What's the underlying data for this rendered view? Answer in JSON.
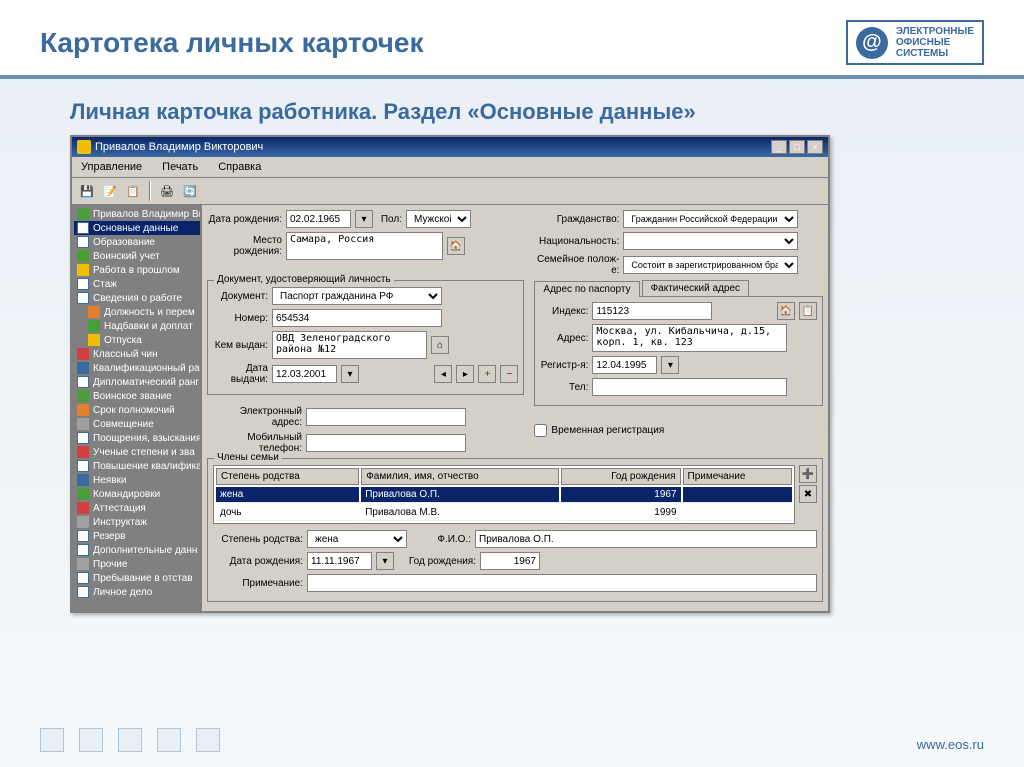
{
  "slide": {
    "title": "Картотека личных карточек",
    "subtitle": "Личная карточка работника. Раздел «Основные данные»",
    "logo_lines": [
      "ЭЛЕКТРОННЫЕ",
      "ОФИСНЫЕ",
      "СИСТЕМЫ"
    ],
    "footer_url": "www.eos.ru"
  },
  "window": {
    "title": "Привалов Владимир Викторович",
    "menu": [
      "Управление",
      "Печать",
      "Справка"
    ]
  },
  "tree": {
    "root": "Привалов Владимир Виктор",
    "items": [
      {
        "label": "Основные данные",
        "selected": true,
        "icon": "ico-doc"
      },
      {
        "label": "Образование",
        "icon": "ico-doc"
      },
      {
        "label": "Воинский учет",
        "icon": "ico-green"
      },
      {
        "label": "Работа в прошлом",
        "icon": "ico-yellow"
      },
      {
        "label": "Стаж",
        "icon": "ico-doc"
      },
      {
        "label": "Сведения о работе",
        "icon": "ico-doc",
        "expanded": true
      },
      {
        "label": "Должность и перем",
        "child": true,
        "icon": "ico-orange"
      },
      {
        "label": "Надбавки и доплат",
        "child": true,
        "icon": "ico-green"
      },
      {
        "label": "Отпуска",
        "child": true,
        "icon": "ico-yellow"
      },
      {
        "label": "Классный чин",
        "icon": "ico-red"
      },
      {
        "label": "Квалификационный ра",
        "icon": "ico-blue"
      },
      {
        "label": "Дипломатический ранг",
        "icon": "ico-doc"
      },
      {
        "label": "Воинское звание",
        "icon": "ico-green"
      },
      {
        "label": "Срок полномочий",
        "icon": "ico-orange"
      },
      {
        "label": "Совмещение",
        "icon": "ico-gray"
      },
      {
        "label": "Поощрения, взыскания",
        "icon": "ico-doc"
      },
      {
        "label": "Ученые степени и зва",
        "icon": "ico-red"
      },
      {
        "label": "Повышение квалифика",
        "icon": "ico-doc"
      },
      {
        "label": "Неявки",
        "icon": "ico-blue"
      },
      {
        "label": "Командировки",
        "icon": "ico-green"
      },
      {
        "label": "Аттестация",
        "icon": "ico-red"
      },
      {
        "label": "Инструктаж",
        "icon": "ico-gray"
      },
      {
        "label": "Резерв",
        "icon": "ico-doc"
      },
      {
        "label": "Дополнительные данн",
        "icon": "ico-doc"
      },
      {
        "label": "Прочие",
        "icon": "ico-gray"
      },
      {
        "label": "Пребывание в отстав",
        "icon": "ico-doc"
      },
      {
        "label": "Личное дело",
        "icon": "ico-doc"
      }
    ]
  },
  "form": {
    "birth_date_label": "Дата рождения:",
    "birth_date": "02.02.1965",
    "sex_label": "Пол:",
    "sex": "Мужской",
    "citizenship_label": "Гражданство:",
    "citizenship": "Гражданин Российской Федерации",
    "birth_place_label": "Место рождения:",
    "birth_place": "Самара, Россия",
    "nationality_label": "Национальность:",
    "nationality": "",
    "marital_label": "Семейное полож-е:",
    "marital": "Состоит в зарегистрированном браке",
    "doc_group": "Документ, удостоверяющий личность",
    "doc_type_label": "Документ:",
    "doc_type": "Паспорт гражданина РФ",
    "doc_num_label": "Номер:",
    "doc_num": "654534",
    "doc_issued_label": "Кем выдан:",
    "doc_issued": "ОВД Зеленоградского района №12",
    "doc_date_label": "Дата выдачи:",
    "doc_date": "12.03.2001",
    "addr_tabs": [
      "Адрес по паспорту",
      "Фактический адрес"
    ],
    "addr_index_label": "Индекс:",
    "addr_index": "115123",
    "addr_label": "Адрес:",
    "addr": "Москва, ул. Кибальчича, д.15, корп. 1, кв. 123",
    "reg_date_label": "Регистр-я:",
    "reg_date": "12.04.1995",
    "tel_label": "Тел:",
    "tel": "",
    "email_label": "Электронный адрес:",
    "email": "",
    "mobile_label": "Мобильный телефон:",
    "mobile": "",
    "temp_reg_label": "Временная регистрация",
    "family_group": "Члены семьи",
    "family_headers": [
      "Степень родства",
      "Фамилия, имя, отчество",
      "Год рождения",
      "Примечание"
    ],
    "family_rows": [
      {
        "rel": "жена",
        "name": "Привалова О.П.",
        "year": "1967",
        "note": "",
        "selected": true
      },
      {
        "rel": "дочь",
        "name": "Привалова М.В.",
        "year": "1999",
        "note": ""
      }
    ],
    "rel_degree_label": "Степень родства:",
    "rel_degree": "жена",
    "fio_label": "Ф.И.О.:",
    "fio": "Привалова О.П.",
    "birth_date2_label": "Дата рождения:",
    "birth_date2": "11.11.1967",
    "birth_year_label": "Год рождения:",
    "birth_year": "1967",
    "note_label": "Примечание:",
    "note": ""
  }
}
